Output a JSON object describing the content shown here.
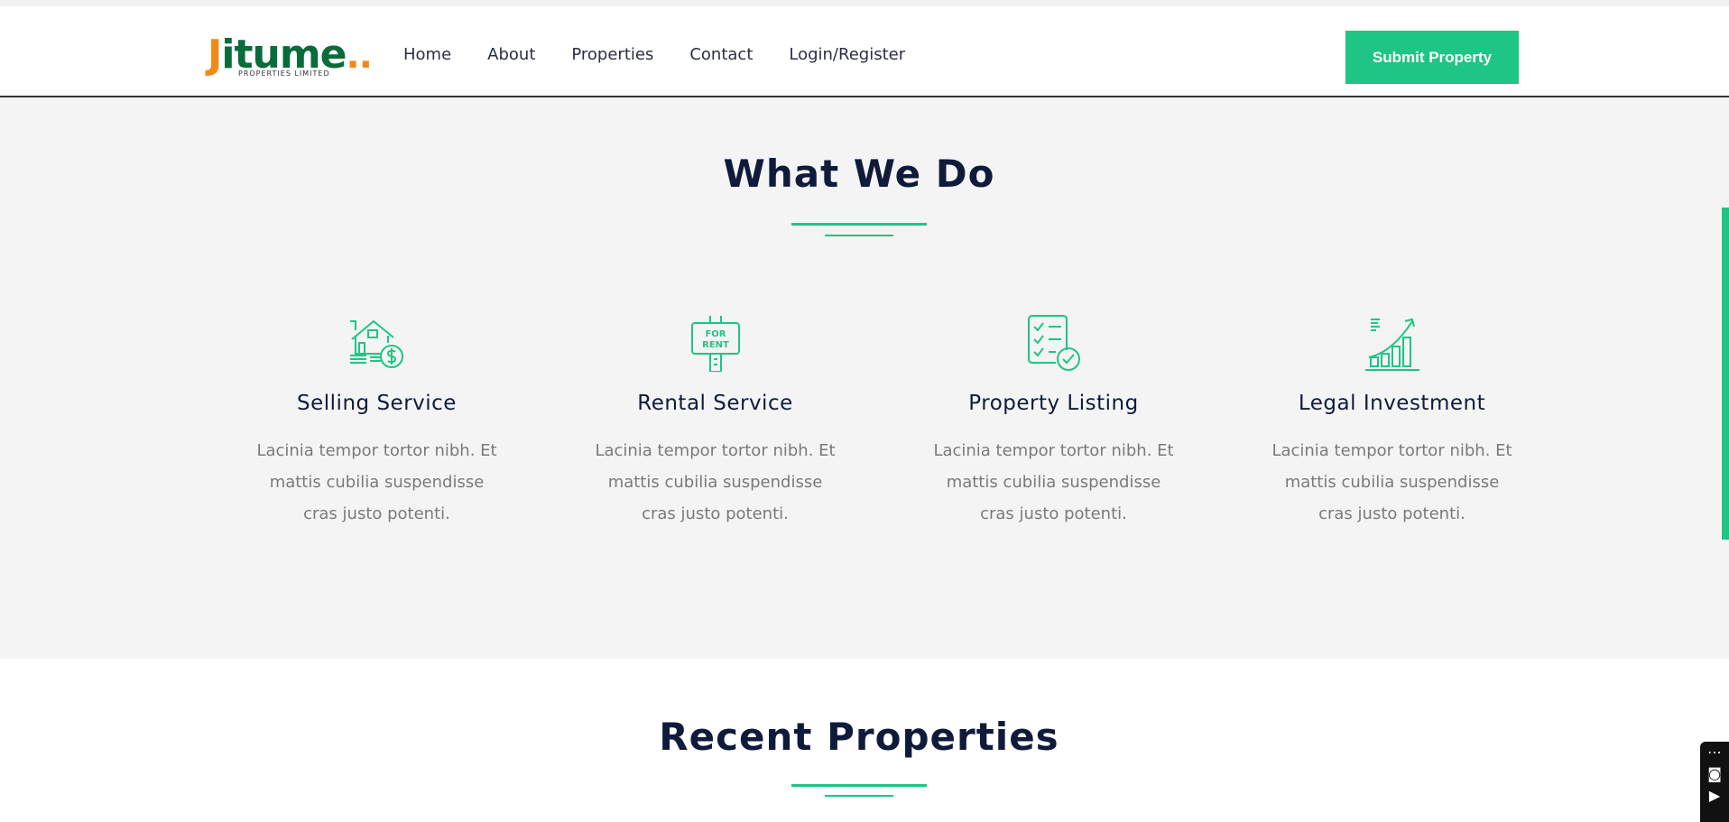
{
  "header": {
    "logo_text_j": "J",
    "logo_text_rest": "itume",
    "logo_dots": "..",
    "logo_sub": "PROPERTIES LIMITED",
    "nav": [
      {
        "label": "Home"
      },
      {
        "label": "About"
      },
      {
        "label": "Properties"
      },
      {
        "label": "Contact"
      },
      {
        "label": "Login/Register"
      }
    ],
    "submit_label": "Submit Property"
  },
  "services": {
    "title": "What We Do",
    "items": [
      {
        "icon": "house-sale-icon",
        "title": "Selling Service",
        "text": "Lacinia tempor tortor nibh. Et mattis cubilia suspendisse cras justo potenti."
      },
      {
        "icon": "for-rent-sign-icon",
        "title": "Rental Service",
        "text": "Lacinia tempor tortor nibh. Et mattis cubilia suspendisse cras justo potenti."
      },
      {
        "icon": "checklist-icon",
        "title": "Property Listing",
        "text": "Lacinia tempor tortor nibh. Et mattis cubilia suspendisse cras justo potenti."
      },
      {
        "icon": "growth-chart-icon",
        "title": "Legal Investment",
        "text": "Lacinia tempor tortor nibh. Et mattis cubilia suspendisse cras justo potenti."
      }
    ],
    "rent_sign_top": "FOR",
    "rent_sign_bottom": "RENT"
  },
  "recent": {
    "title": "Recent Properties"
  },
  "colors": {
    "accent": "#1ec584",
    "heading": "#101b3b",
    "body_text": "#7a7a7a",
    "section_bg": "#f4f4f4",
    "logo_green": "#0a6b3b",
    "logo_orange": "#f08a18"
  }
}
